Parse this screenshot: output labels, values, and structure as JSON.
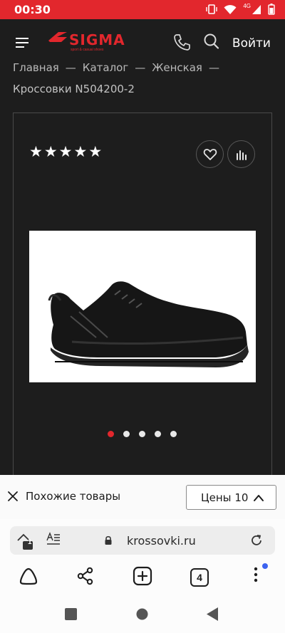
{
  "status_bar": {
    "time": "00:30",
    "network": "4G"
  },
  "header": {
    "logo_text": "SIGMA",
    "logo_tagline": "sport & casual shoes",
    "login_label": "Войти",
    "brand_color": "#e2272d"
  },
  "breadcrumbs": {
    "items": [
      "Главная",
      "Каталог",
      "Женская"
    ],
    "separator": "—"
  },
  "product": {
    "title": "Кроссовки N504200-2",
    "rating_stars": 5,
    "rating_max": 5,
    "image_icon": "black-sneaker-photo",
    "gallery_total": 5,
    "gallery_active_index": 0
  },
  "filter_bar": {
    "similar_label": "Похожие товары",
    "price_label": "Цены",
    "price_count": "10"
  },
  "browser": {
    "url": "krossovki.ru",
    "tab_count": "4",
    "badge_count": "1"
  },
  "stars_glyph": "★"
}
